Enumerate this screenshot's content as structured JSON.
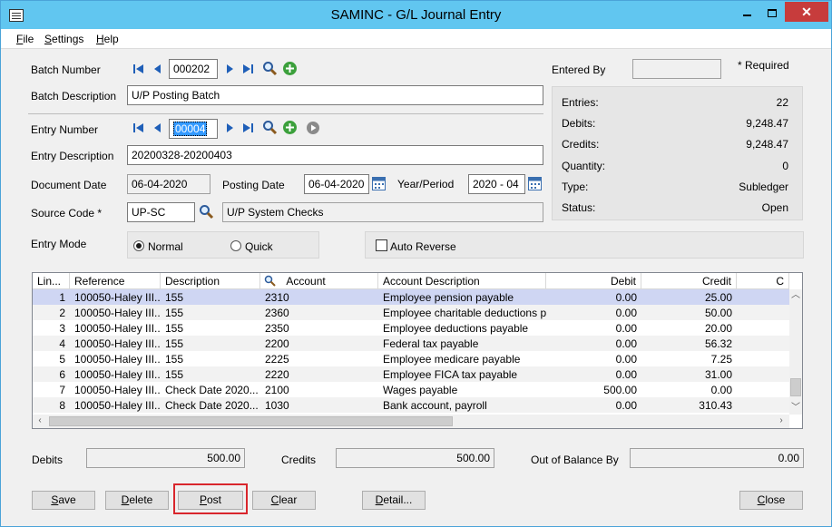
{
  "window": {
    "title": "SAMINC - G/L Journal Entry",
    "min_icon": "minimize-icon",
    "max_icon": "maximize-icon",
    "close_icon": "close-icon",
    "close_glyph": "✕"
  },
  "menu": [
    "File",
    "Settings",
    "Help"
  ],
  "batch": {
    "number_label": "Batch Number",
    "number": "000202",
    "description_label": "Batch Description",
    "description": "U/P Posting Batch"
  },
  "entry": {
    "number_label": "Entry Number",
    "number": "00004",
    "description_label": "Entry Description",
    "description": "20200328-20200403",
    "document_date_label": "Document Date",
    "document_date": "06-04-2020",
    "posting_date_label": "Posting Date",
    "posting_date": "06-04-2020",
    "year_period_label": "Year/Period",
    "year_period": "2020 - 04",
    "source_code_label": "Source Code *",
    "source_code": "UP-SC",
    "source_description": "U/P System Checks",
    "entry_mode_label": "Entry Mode",
    "mode_normal": "Normal",
    "mode_quick": "Quick",
    "selected_mode": "Normal",
    "auto_reverse_label": "Auto Reverse",
    "auto_reverse": false
  },
  "entered_by": {
    "label": "Entered By",
    "value": "",
    "required_note": "* Required"
  },
  "summary": [
    {
      "key": "Entries:",
      "value": "22"
    },
    {
      "key": "Debits:",
      "value": "9,248.47"
    },
    {
      "key": "Credits:",
      "value": "9,248.47"
    },
    {
      "key": "Quantity:",
      "value": "0"
    },
    {
      "key": "Type:",
      "value": "Subledger"
    },
    {
      "key": "Status:",
      "value": "Open"
    }
  ],
  "grid": {
    "columns": [
      "Lin...",
      "Reference",
      "Description",
      "Account",
      "Account Description",
      "Debit",
      "Credit",
      "C"
    ],
    "rows": [
      {
        "line": "1",
        "reference": "100050-Haley III...",
        "description": "155",
        "account": "2310",
        "account_description": "Employee pension payable",
        "debit": "0.00",
        "credit": "25.00"
      },
      {
        "line": "2",
        "reference": "100050-Haley III...",
        "description": "155",
        "account": "2360",
        "account_description": "Employee charitable deductions p...",
        "debit": "0.00",
        "credit": "50.00"
      },
      {
        "line": "3",
        "reference": "100050-Haley III...",
        "description": "155",
        "account": "2350",
        "account_description": "Employee deductions payable",
        "debit": "0.00",
        "credit": "20.00"
      },
      {
        "line": "4",
        "reference": "100050-Haley III...",
        "description": "155",
        "account": "2200",
        "account_description": "Federal tax payable",
        "debit": "0.00",
        "credit": "56.32"
      },
      {
        "line": "5",
        "reference": "100050-Haley III...",
        "description": "155",
        "account": "2225",
        "account_description": "Employee medicare payable",
        "debit": "0.00",
        "credit": "7.25"
      },
      {
        "line": "6",
        "reference": "100050-Haley III...",
        "description": "155",
        "account": "2220",
        "account_description": "Employee FICA tax payable",
        "debit": "0.00",
        "credit": "31.00"
      },
      {
        "line": "7",
        "reference": "100050-Haley III...",
        "description": "Check Date 2020...",
        "account": "2100",
        "account_description": "Wages payable",
        "debit": "500.00",
        "credit": "0.00"
      },
      {
        "line": "8",
        "reference": "100050-Haley III...",
        "description": "Check Date 2020...",
        "account": "1030",
        "account_description": "Bank account, payroll",
        "debit": "0.00",
        "credit": "310.43"
      }
    ]
  },
  "totals": {
    "debits_label": "Debits",
    "debits": "500.00",
    "credits_label": "Credits",
    "credits": "500.00",
    "out_of_balance_label": "Out of Balance By",
    "out_of_balance": "0.00"
  },
  "buttons": {
    "save": "Save",
    "delete": "Delete",
    "post": "Post",
    "clear": "Clear",
    "detail": "Detail...",
    "close": "Close"
  },
  "colors": {
    "titlebar": "#61c6f0",
    "selected_row": "#cfd6f3",
    "focus_outline": "#d9262c",
    "nav_arrow": "#1f5fb8",
    "add_icon": "#3ca03c"
  }
}
